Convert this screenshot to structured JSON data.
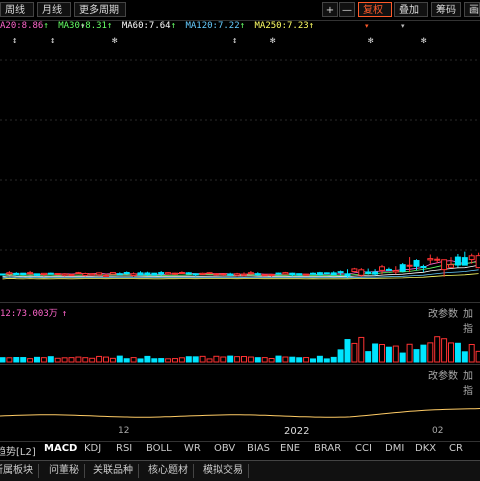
{
  "toolbar": {
    "period_day": "周线",
    "period_month": "月线",
    "more_periods": "更多周期",
    "plus": "+",
    "minus": "—",
    "rights": "复权",
    "overlay": "叠加",
    "chips": "筹码",
    "draw": "画"
  },
  "ma": [
    {
      "label": "A20:8.86",
      "color": "#ff66cc",
      "arrow": "↑",
      "arrow_color": "#66ff66"
    },
    {
      "label": "MA30:8.31",
      "color": "#66ff66",
      "arrow": "↑",
      "arrow_color": "#66ff66"
    },
    {
      "label": "MA60:7.64",
      "color": "#ffffff",
      "arrow": "↑",
      "arrow_color": "#66ff66"
    },
    {
      "label": "MA120:7.22",
      "color": "#66ccff",
      "arrow": "↑",
      "arrow_color": "#66ff66"
    },
    {
      "label": "MA250:7.23",
      "color": "#ffff66",
      "arrow": "↑",
      "arrow_color": "#ffff66"
    }
  ],
  "markers": [
    "↕",
    "↕",
    "✻",
    "↕",
    "✻",
    "✻",
    "✻"
  ],
  "volume_label": "12:73.003万",
  "volume_arrow": "↑",
  "panel_links": {
    "change_params": "改参数",
    "add_indicator": "加指"
  },
  "x_axis": {
    "label_12": "12",
    "label_2022": "2022",
    "label_02": "02"
  },
  "indicator_tabs": [
    "趋势[L2]",
    "MACD",
    "KDJ",
    "RSI",
    "BOLL",
    "WR",
    "OBV",
    "BIAS",
    "ENE",
    "BRAR",
    "CCI",
    "DMI",
    "DKX",
    "CR"
  ],
  "bottom_tabs": [
    "所属板块",
    "问董秘",
    "关联品种",
    "核心题材",
    "模拟交易"
  ],
  "colors": {
    "up": "#ff3333",
    "down": "#00e5ff",
    "active": "#ff5a2a"
  }
}
